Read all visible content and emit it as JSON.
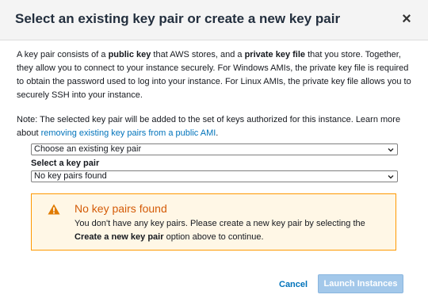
{
  "modal": {
    "title": "Select an existing key pair or create a new key pair",
    "close_symbol": "×"
  },
  "intro": {
    "t1": "A key pair consists of a ",
    "b1": "public key",
    "t2": " that AWS stores, and a ",
    "b2": "private key file",
    "t3": " that you store. Together, they allow you to connect to your instance securely. For Windows AMIs, the private key file is required to obtain the password used to log into your instance. For Linux AMIs, the private key file allows you to securely SSH into your instance."
  },
  "note": {
    "text": "Note: The selected key pair will be added to the set of keys authorized for this instance. Learn more about ",
    "link": "removing existing key pairs from a public AMI",
    "end": "."
  },
  "key_pair_mode_select": {
    "value": "Choose an existing key pair"
  },
  "key_pair_select": {
    "label": "Select a key pair",
    "value": "No key pairs found"
  },
  "alert": {
    "title": "No key pairs found",
    "t1": "You don't have any key pairs. Please create a new key pair by selecting the ",
    "bold": "Create a new key pair",
    "t2": " option above to continue.",
    "icon": "warning-triangle-icon",
    "color": "#ff9900"
  },
  "footer": {
    "cancel_label": "Cancel",
    "launch_label": "Launch Instances"
  }
}
